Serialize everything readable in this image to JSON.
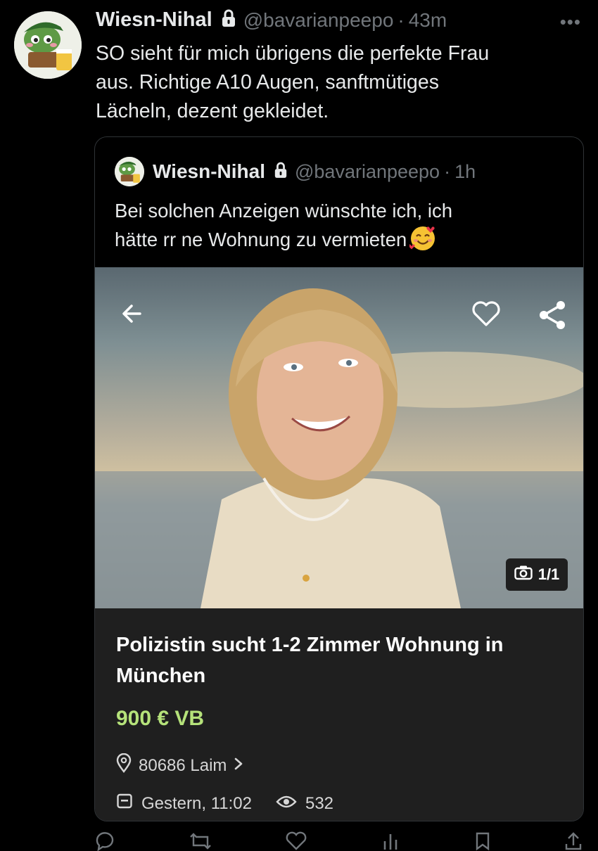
{
  "tweet": {
    "author_name": "Wiesn-Nihal",
    "author_handle": "@bavarianpeepo",
    "separator": "·",
    "time": "43m",
    "more_label": "•••",
    "text": "SO sieht für mich übrigens die perfekte Frau\naus. Richtige A10 Augen, sanftmütiges\nLächeln, dezent gekleidet."
  },
  "quote": {
    "author_name": "Wiesn-Nihal",
    "author_handle": "@bavarianpeepo",
    "separator": "·",
    "time": "1h",
    "text": "Bei solchen Anzeigen wünschte ich, ich\nhätte rr ne Wohnung zu vermieten",
    "emoji": "smiling-face-with-hearts",
    "listing": {
      "photo_counter": "1/1",
      "title": "Polizistin sucht 1-2 Zimmer Wohnung in München",
      "price": "900 € VB",
      "location": "80686 Laim",
      "date": "Gestern, 11:02",
      "views": "532"
    }
  },
  "icons": {
    "lock": "lock-icon",
    "back": "arrow-left-icon",
    "heart": "heart-icon",
    "share": "share-icon",
    "camera": "camera-icon",
    "pin": "map-pin-icon",
    "calendar": "calendar-icon",
    "eye": "eye-icon"
  },
  "colors": {
    "background": "#000000",
    "text": "#e7e9ea",
    "muted": "#71767b",
    "card": "#1f1f1f",
    "price": "#b5e27a"
  }
}
